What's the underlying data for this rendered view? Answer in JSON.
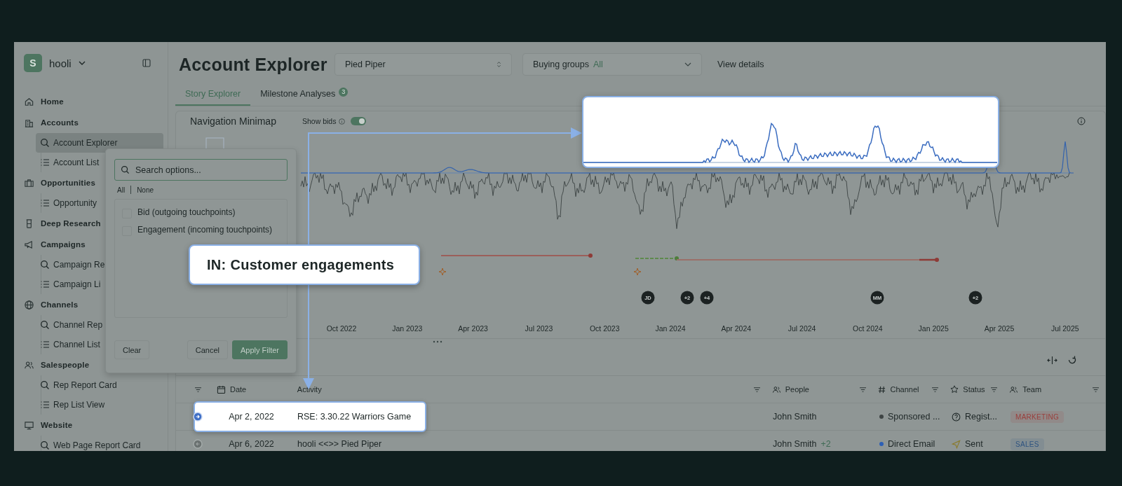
{
  "workspace": {
    "initial": "S",
    "name": "hooli"
  },
  "sidebar": {
    "items": [
      {
        "label": "Home"
      },
      {
        "label": "Accounts",
        "children": [
          {
            "label": "Account Explorer",
            "kind": "report",
            "selected": true
          },
          {
            "label": "Account List",
            "kind": "list",
            "selected": false
          }
        ]
      },
      {
        "label": "Opportunities",
        "children": [
          {
            "label": "Opportunity",
            "kind": "list",
            "selected": false
          }
        ]
      },
      {
        "label": "Deep Research"
      },
      {
        "label": "Campaigns",
        "children": [
          {
            "label": "Campaign Re",
            "kind": "report",
            "selected": false
          },
          {
            "label": "Campaign Li",
            "kind": "list",
            "selected": false
          }
        ]
      },
      {
        "label": "Channels",
        "children": [
          {
            "label": "Channel Rep",
            "kind": "report",
            "selected": false
          },
          {
            "label": "Channel List",
            "kind": "list",
            "selected": false
          }
        ]
      },
      {
        "label": "Salespeople",
        "children": [
          {
            "label": "Rep Report Card",
            "kind": "report",
            "selected": false
          },
          {
            "label": "Rep List View",
            "kind": "list",
            "selected": false
          }
        ]
      },
      {
        "label": "Website",
        "children": [
          {
            "label": "Web Page Report Card",
            "kind": "report",
            "selected": false
          }
        ]
      }
    ]
  },
  "header": {
    "title": "Account Explorer",
    "account_select": {
      "value": "Pied Piper"
    },
    "buying_groups": {
      "label": "Buying groups",
      "value": "All"
    },
    "view_details": "View details"
  },
  "tabs": [
    {
      "label": "Story Explorer",
      "selected": true
    },
    {
      "label": "Milestone Analyses",
      "selected": false,
      "badge": "3"
    }
  ],
  "minimap": {
    "title": "Navigation Minimap",
    "show_bids": {
      "label": "Show bids",
      "on": true
    },
    "timeline_labels": [
      "Oct 2022",
      "Jan 2023",
      "Apr 2023",
      "Jul 2023",
      "Oct 2023",
      "Jan 2024",
      "Apr 2024",
      "Jul 2024",
      "Oct 2024",
      "Jan 2025",
      "Apr 2025",
      "Jul 2025"
    ],
    "avatars": [
      "JD",
      "+2",
      "+4",
      "MM",
      "+2"
    ]
  },
  "filter_popover": {
    "search": {
      "placeholder": "Search options..."
    },
    "select_all": "All",
    "select_none": "None",
    "options": [
      {
        "label": "Bid (outgoing touchpoints)",
        "checked": false
      },
      {
        "label": "Engagement (incoming touchpoints)",
        "checked": false
      }
    ],
    "buttons": [
      {
        "label": "Clear",
        "kind": "plain"
      },
      {
        "label": "Cancel",
        "kind": "plain"
      },
      {
        "label": "Apply Filter",
        "kind": "primary"
      }
    ]
  },
  "callout": {
    "label": "IN: Customer engagements"
  },
  "table": {
    "columns": [
      {
        "label": "Date"
      },
      {
        "label": "Activity"
      },
      {
        "label": "People"
      },
      {
        "label": "Channel"
      },
      {
        "label": "Status"
      },
      {
        "label": "Team"
      }
    ],
    "rows": [
      {
        "kind": "incoming",
        "highlighted": true,
        "date": "Apr 2, 2022",
        "activity": "RSE: 3.30.22 Warriors Game",
        "people": "John Smith",
        "channel": {
          "label": "Sponsored ...",
          "color": "#3e4444"
        },
        "status": {
          "label": "Regist...",
          "kind": "registered"
        },
        "team": {
          "label": "MARKETING",
          "color": "#9a3e3b"
        }
      },
      {
        "kind": "outgoing",
        "highlighted": false,
        "date": "Apr 6, 2022",
        "activity": "hooli <<>> Pied Piper",
        "people": "John Smith",
        "people_extra": "+2",
        "channel": {
          "label": "Direct Email",
          "color": "#2d5fb5"
        },
        "status": {
          "label": "Sent",
          "kind": "sent"
        },
        "team": {
          "label": "SALES",
          "color": "#2f5480"
        }
      }
    ]
  }
}
